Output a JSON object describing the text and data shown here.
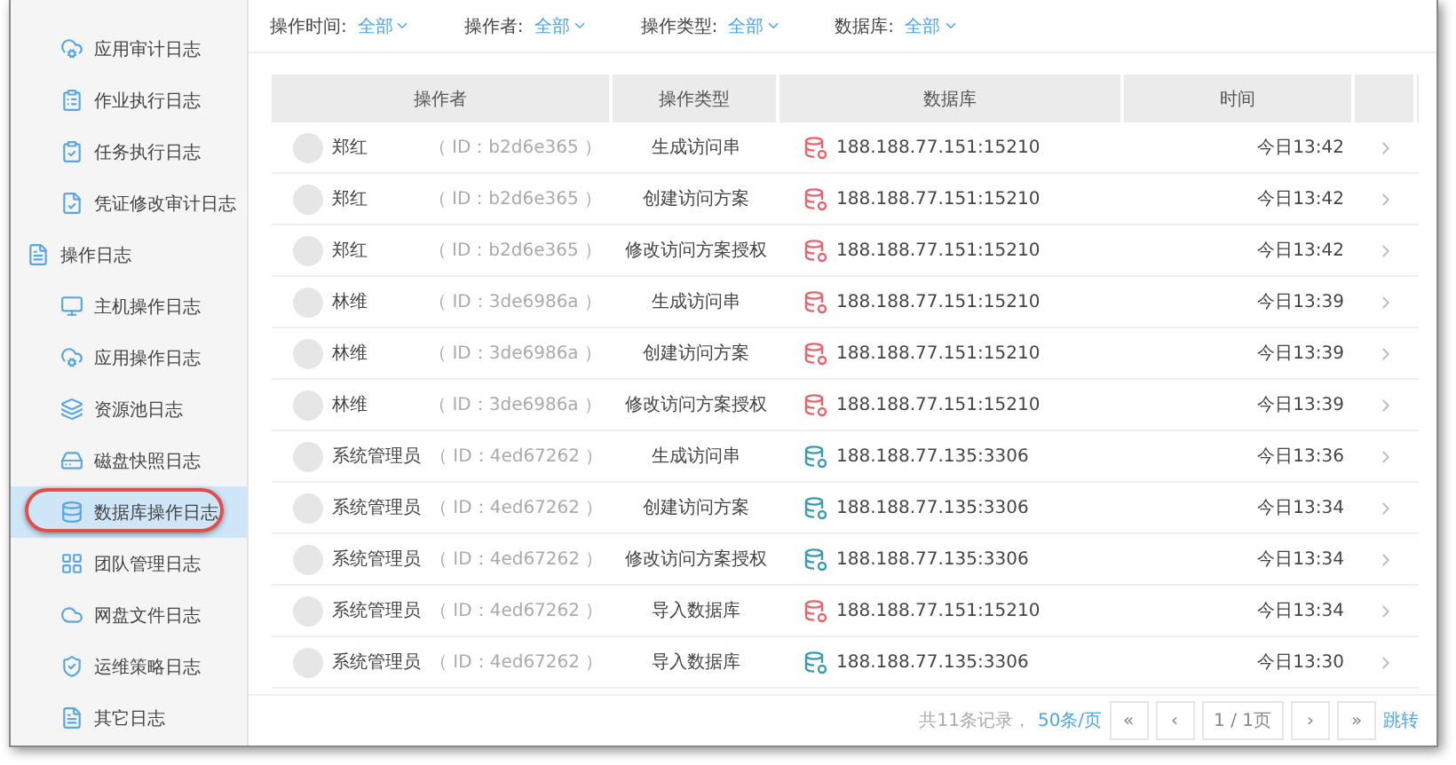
{
  "sidebar": {
    "items": [
      {
        "label": "应用审计日志",
        "selected": false
      },
      {
        "label": "作业执行日志",
        "selected": false
      },
      {
        "label": "任务执行日志",
        "selected": false
      },
      {
        "label": "凭证修改审计日志",
        "selected": false
      }
    ],
    "sections": [
      {
        "label": "操作日志",
        "children": [
          {
            "label": "主机操作日志",
            "selected": false
          },
          {
            "label": "应用操作日志",
            "selected": false
          },
          {
            "label": "资源池日志",
            "selected": false
          },
          {
            "label": "磁盘快照日志",
            "selected": false
          },
          {
            "label": "数据库操作日志",
            "selected": true
          },
          {
            "label": "团队管理日志",
            "selected": false
          },
          {
            "label": "网盘文件日志",
            "selected": false
          },
          {
            "label": "运维策略日志",
            "selected": false
          },
          {
            "label": "其它日志",
            "selected": false
          }
        ]
      }
    ]
  },
  "filters": [
    {
      "label": "操作时间:",
      "value": "全部"
    },
    {
      "label": "操作者:",
      "value": "全部"
    },
    {
      "label": "操作类型:",
      "value": "全部"
    },
    {
      "label": "数据库:",
      "value": "全部"
    }
  ],
  "table": {
    "columns": [
      "操作者",
      "操作类型",
      "数据库",
      "时间"
    ],
    "rows": [
      {
        "name": "郑红",
        "id": "（ ID：b2d6e365 ）",
        "type": "生成访问串",
        "db": "188.188.77.151:15210",
        "color": "#e8646c",
        "time": "今日13:42"
      },
      {
        "name": "郑红",
        "id": "（ ID：b2d6e365 ）",
        "type": "创建访问方案",
        "db": "188.188.77.151:15210",
        "color": "#e8646c",
        "time": "今日13:42"
      },
      {
        "name": "郑红",
        "id": "（ ID：b2d6e365 ）",
        "type": "修改访问方案授权",
        "db": "188.188.77.151:15210",
        "color": "#e8646c",
        "time": "今日13:42"
      },
      {
        "name": "林维",
        "id": "（ ID：3de6986a ）",
        "type": "生成访问串",
        "db": "188.188.77.151:15210",
        "color": "#e8646c",
        "time": "今日13:39"
      },
      {
        "name": "林维",
        "id": "（ ID：3de6986a ）",
        "type": "创建访问方案",
        "db": "188.188.77.151:15210",
        "color": "#e8646c",
        "time": "今日13:39"
      },
      {
        "name": "林维",
        "id": "（ ID：3de6986a ）",
        "type": "修改访问方案授权",
        "db": "188.188.77.151:15210",
        "color": "#e8646c",
        "time": "今日13:39"
      },
      {
        "name": "系统管理员",
        "id": "（ ID：4ed67262 ）",
        "type": "生成访问串",
        "db": "188.188.77.135:3306",
        "color": "#3a9bb0",
        "time": "今日13:36"
      },
      {
        "name": "系统管理员",
        "id": "（ ID：4ed67262 ）",
        "type": "创建访问方案",
        "db": "188.188.77.135:3306",
        "color": "#3a9bb0",
        "time": "今日13:34"
      },
      {
        "name": "系统管理员",
        "id": "（ ID：4ed67262 ）",
        "type": "修改访问方案授权",
        "db": "188.188.77.135:3306",
        "color": "#3a9bb0",
        "time": "今日13:34"
      },
      {
        "name": "系统管理员",
        "id": "（ ID：4ed67262 ）",
        "type": "导入数据库",
        "db": "188.188.77.151:15210",
        "color": "#e8646c",
        "time": "今日13:34"
      },
      {
        "name": "系统管理员",
        "id": "（ ID：4ed67262 ）",
        "type": "导入数据库",
        "db": "188.188.77.135:3306",
        "color": "#3a9bb0",
        "time": "今日13:30"
      }
    ]
  },
  "pagination": {
    "total": "共11条记录，",
    "page_size": "50条/页",
    "first": "«",
    "prev": "‹",
    "page": "1 / 1页",
    "next": "›",
    "last": "»",
    "jump": "跳转"
  }
}
